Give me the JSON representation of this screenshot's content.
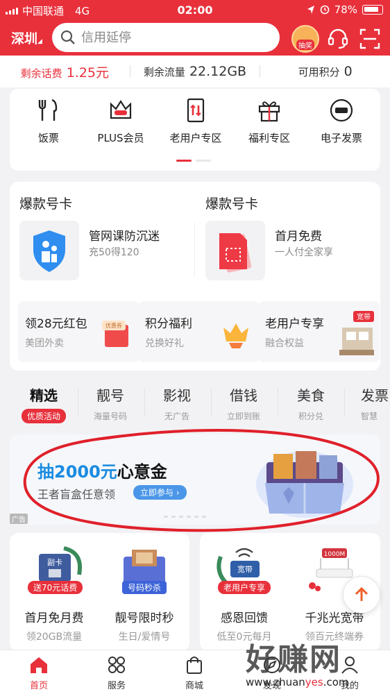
{
  "status_bar": {
    "carrier": "中国联通",
    "network": "4G",
    "time": "02:00",
    "battery": "78%"
  },
  "header": {
    "city": "深圳",
    "search_placeholder": "信用延停",
    "lottery_label": "抽奖"
  },
  "balance": [
    {
      "label": "剩余话费",
      "value": "1.25元"
    },
    {
      "label": "剩余流量",
      "value": "22.12GB"
    },
    {
      "label": "可用积分",
      "value": "0"
    }
  ],
  "quick_menu": [
    {
      "label": "饭票",
      "icon": "fork-knife-icon"
    },
    {
      "label": "PLUS会员",
      "icon": "crown-plus-icon"
    },
    {
      "label": "老用户专区",
      "icon": "phone-card-icon"
    },
    {
      "label": "福利专区",
      "icon": "gift-icon"
    },
    {
      "label": "电子发票",
      "icon": "invoice-icon"
    }
  ],
  "promo": {
    "left": {
      "title": "爆款号卡",
      "name": "管网课防沉迷",
      "desc": "充50得120"
    },
    "right": {
      "title": "爆款号卡",
      "name": "首月免费",
      "desc": "一人付全家享"
    },
    "subs": [
      {
        "title": "领28元红包",
        "desc": "美团外卖",
        "badge": "优惠券"
      },
      {
        "title": "积分福利",
        "desc": "兑换好礼"
      },
      {
        "title": "老用户专享",
        "desc": "融合权益",
        "badge": "宽带"
      }
    ]
  },
  "tabs": [
    {
      "label": "精选",
      "sub": "优质活动"
    },
    {
      "label": "靓号",
      "sub": "海量号码"
    },
    {
      "label": "影视",
      "sub": "无广告"
    },
    {
      "label": "借钱",
      "sub": "立即到账"
    },
    {
      "label": "美食",
      "sub": "积分兑"
    },
    {
      "label": "发票",
      "sub": "智慧"
    }
  ],
  "banner": {
    "title_highlight": "抽2000元",
    "title_rest": "心意金",
    "subtitle": "王者盲盒任意领",
    "cta": "立即参与",
    "ad_label": "广告"
  },
  "bottom_cards": [
    {
      "title": "首月免月费",
      "desc": "领20GB流量",
      "badge": "送70元话费",
      "card_label": "副卡"
    },
    {
      "title": "靓号限时秒",
      "desc": "生日/爱情号",
      "badge": "号码秒杀"
    },
    {
      "title": "感恩回馈",
      "desc": "低至0元每月",
      "badge": "老用户专享",
      "card_label": "宽带"
    },
    {
      "title": "千兆光宽带",
      "desc": "领百元终端券",
      "card_label": "1000M"
    }
  ],
  "tab_bar": [
    {
      "label": "首页"
    },
    {
      "label": "服务"
    },
    {
      "label": "商城"
    },
    {
      "label": "发现"
    },
    {
      "label": "我的"
    }
  ],
  "watermark": {
    "text": "好赚网",
    "url_prefix": "www.zhuan",
    "url_highlight": "yes",
    "url_suffix": ".com"
  },
  "colors": {
    "brand_red": "#e8303b",
    "link_blue": "#1a8be0"
  }
}
